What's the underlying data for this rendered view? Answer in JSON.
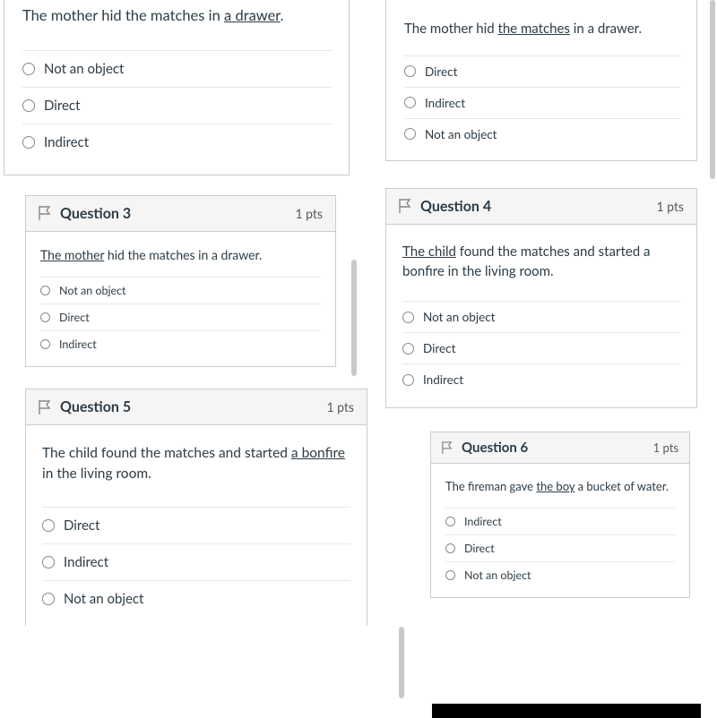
{
  "top_left": {
    "prompt_pre": "The mother hid the matches in ",
    "prompt_u": "a drawer",
    "prompt_post": ".",
    "options": [
      "Not an object",
      "Direct",
      "Indirect"
    ]
  },
  "top_right": {
    "prompt_pre": "The mother hid ",
    "prompt_u": "the matches",
    "prompt_post": " in a drawer.",
    "options": [
      "Direct",
      "Indirect",
      "Not an object"
    ]
  },
  "q3": {
    "title": "Question 3",
    "pts": "1 pts",
    "prompt_u": "The mother",
    "prompt_post": " hid the matches in a drawer.",
    "options": [
      "Not an object",
      "Direct",
      "Indirect"
    ]
  },
  "q4": {
    "title": "Question 4",
    "pts": "1 pts",
    "prompt_u": "The child",
    "prompt_post": " found the matches and started a bonfire in the living room.",
    "options": [
      "Not an object",
      "Direct",
      "Indirect"
    ]
  },
  "q5": {
    "title": "Question 5",
    "pts": "1 pts",
    "prompt_pre": "The child found the matches and started ",
    "prompt_u": "a bonfire",
    "prompt_post": " in the living room.",
    "options": [
      "Direct",
      "Indirect",
      "Not an object"
    ]
  },
  "q6": {
    "title": "Question 6",
    "pts": "1 pts",
    "prompt_pre": "The fireman gave ",
    "prompt_u": "the boy",
    "prompt_post": " a bucket of water.",
    "options": [
      "Indirect",
      "Direct",
      "Not an object"
    ]
  }
}
